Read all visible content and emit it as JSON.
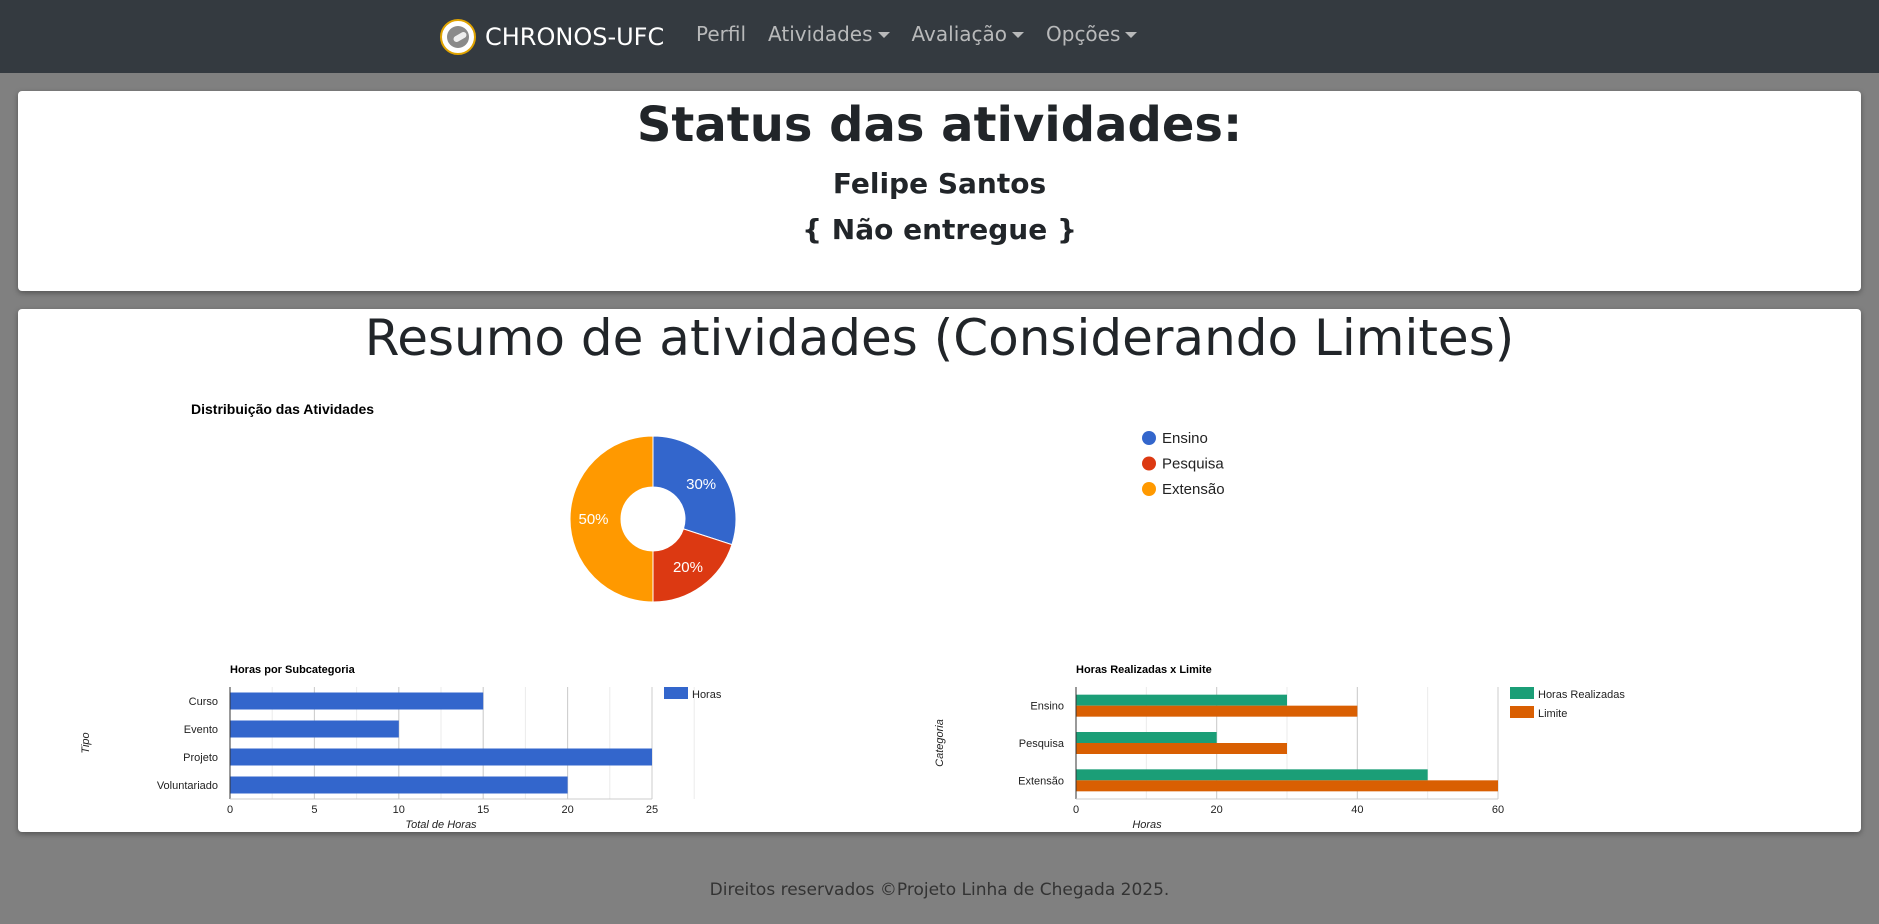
{
  "navbar": {
    "brand": "CHRONOS-UFC",
    "items": [
      {
        "label": "Perfil",
        "dropdown": false
      },
      {
        "label": "Atividades",
        "dropdown": true
      },
      {
        "label": "Avaliação",
        "dropdown": true
      },
      {
        "label": "Opções",
        "dropdown": true
      }
    ]
  },
  "status": {
    "title": "Status das atividades:",
    "student_name": "Felipe Santos",
    "state": "{ Não entregue }"
  },
  "resumo": {
    "title": "Resumo de atividades (Considerando Limites)"
  },
  "chart_data": [
    {
      "type": "pie",
      "title": "Distribuição das Atividades",
      "categories": [
        "Ensino",
        "Pesquisa",
        "Extensão"
      ],
      "values": [
        30,
        20,
        50
      ],
      "labels": [
        "30%",
        "20%",
        "50%"
      ],
      "colors": [
        "#3366cc",
        "#dc3912",
        "#ff9900"
      ],
      "donut": true,
      "legend": "right"
    },
    {
      "type": "bar",
      "orientation": "horizontal",
      "title": "Horas por Subcategoria",
      "categories": [
        "Curso",
        "Evento",
        "Projeto",
        "Voluntariado"
      ],
      "series": [
        {
          "name": "Horas",
          "values": [
            15,
            10,
            25,
            20
          ],
          "color": "#3366cc"
        }
      ],
      "xlabel": "Total de Horas",
      "ylabel": "Tipo",
      "xlim": [
        0,
        25
      ],
      "xticks": [
        0,
        5,
        10,
        15,
        20,
        25
      ],
      "grid": true,
      "legend": "top-right"
    },
    {
      "type": "bar",
      "orientation": "horizontal",
      "title": "Horas Realizadas x Limite",
      "categories": [
        "Ensino",
        "Pesquisa",
        "Extensão"
      ],
      "series": [
        {
          "name": "Horas Realizadas",
          "values": [
            30,
            20,
            50
          ],
          "color": "#1b9e77"
        },
        {
          "name": "Limite",
          "values": [
            40,
            30,
            60
          ],
          "color": "#d95f02"
        }
      ],
      "xlabel": "Horas",
      "ylabel": "Categoria",
      "xlim": [
        0,
        60
      ],
      "xticks": [
        0,
        20,
        40,
        60
      ],
      "grid": true,
      "legend": "top-right"
    }
  ],
  "footer": {
    "text": "Direitos reservados ©Projeto Linha de Chegada 2025."
  }
}
